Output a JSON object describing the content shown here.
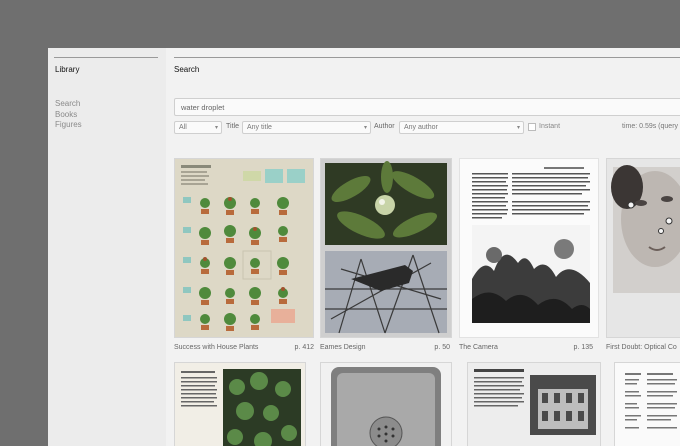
{
  "sidebar": {
    "title": "Library",
    "items": [
      {
        "label": "Search"
      },
      {
        "label": "Books"
      },
      {
        "label": "Figures"
      }
    ]
  },
  "main": {
    "title": "Search",
    "search": {
      "value": "water droplet"
    },
    "filters": {
      "type": "All",
      "title_label": "Title",
      "title_value": "Any title",
      "author_label": "Author",
      "author_value": "Any author",
      "instant_label": "Instant",
      "timing": "time: 0.59s (query"
    },
    "results": [
      {
        "caption": "Success with House Plants",
        "page": "p. 412"
      },
      {
        "caption": "Eames Design",
        "page": "p. 50"
      },
      {
        "caption": "The Camera",
        "page": "p. 135"
      },
      {
        "caption": "First Doubt: Optical Co",
        "page": ""
      }
    ]
  }
}
